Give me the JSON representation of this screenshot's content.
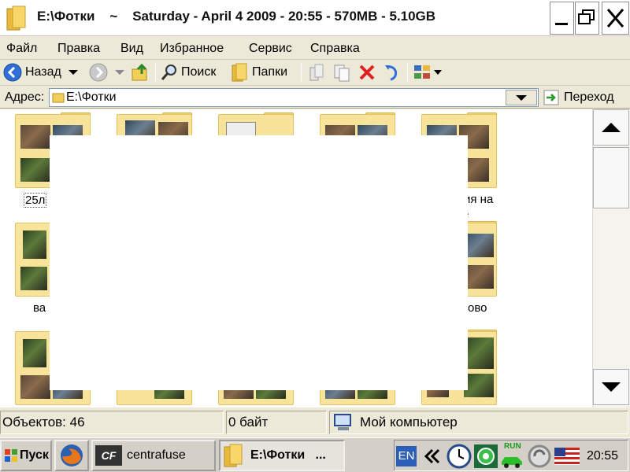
{
  "window": {
    "title": "E:\\Фотки    ~    Saturday - April 4 2009 - 20:55 - 570MB - 5.10GB"
  },
  "menu": [
    "Файл",
    "Правка",
    "Вид",
    "Избранное",
    "Сервис",
    "Справка"
  ],
  "toolbar": {
    "back": "Назад",
    "search": "Поиск",
    "folders": "Папки"
  },
  "address": {
    "label": "Адрес:",
    "value": "E:\\Фотки",
    "go": "Переход"
  },
  "folders": {
    "row1": [
      {
        "label": "25л"
      },
      {
        "label": ""
      },
      {
        "label": ""
      },
      {
        "label": ""
      },
      {
        "label": "ия на",
        "label2": "е"
      }
    ],
    "row2": [
      {
        "label": "ва"
      },
      {
        "label": ""
      },
      {
        "label": ""
      },
      {
        "label": ""
      },
      {
        "label": "ово"
      }
    ],
    "row3": [
      {
        "label": ""
      },
      {
        "label": ""
      },
      {
        "label": ""
      },
      {
        "label": ""
      },
      {
        "label": ""
      }
    ]
  },
  "status": {
    "objects": "Объектов: 46",
    "size": "0 байт",
    "location": "Мой компьютер"
  },
  "taskbar": {
    "start": "Пуск",
    "task1": "centrafuse",
    "task1_icon": "CF",
    "task2": "E:\\Фотки   ...",
    "lang": "EN",
    "tray_label": "RUN",
    "clock": "20:55"
  }
}
